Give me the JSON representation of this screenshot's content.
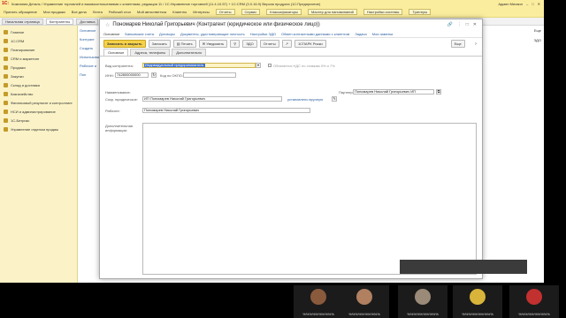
{
  "app": {
    "logo": "1С:",
    "window_title": "Компания Деталь / Управление торговлей и взаимоотношениями с клиентами, редакция 11 / 1С:Управление торговлей (11.4.10.57) + 1С:CRM (3.0.16.9) Версия продукта (1С:Предприятие)",
    "user": "Админ Михаил"
  },
  "menu": {
    "items": [
      "Принять обращение",
      "Мои продажи",
      "Все дела",
      "Лента",
      "Рабочий стол",
      "Мой автоответчик",
      "Клиенты",
      "Интересы"
    ],
    "dropdowns": [
      "Отчеты",
      "Сервис",
      "Классификаторы",
      "Мастер для напоминаний",
      "Настройки системы",
      "Триггеры"
    ]
  },
  "tabs": [
    "Начальная страница",
    "Контрагенты",
    "Доставка"
  ],
  "sidebar": {
    "items": [
      {
        "label": "Главное"
      },
      {
        "label": "1С:CRM"
      },
      {
        "label": "Планирование"
      },
      {
        "label": "CRM и маркетинг"
      },
      {
        "label": "Продажи"
      },
      {
        "label": "Закупки"
      },
      {
        "label": "Склад и доставка"
      },
      {
        "label": "Казначейство"
      },
      {
        "label": "Финансовый результат и контроллинг"
      },
      {
        "label": "НСИ и администрирование"
      },
      {
        "label": "1С-Битрикс"
      },
      {
        "label": "Управление отделом продаж"
      }
    ]
  },
  "background": {
    "left": [
      "Основное",
      "Контраге",
      "Создать",
      "Использование",
      "Рабочие и",
      "Пон"
    ],
    "right": [
      "Еще",
      "ЭДО",
      ""
    ]
  },
  "form": {
    "title": "Пономарев Николай Григорьевич (Контрагент (юридическое или физическое лицо))",
    "title_star": "☆",
    "links": [
      "Основное",
      "Банковские счета",
      "Договоры",
      "Документы, удостоверяющие личность",
      "Настройки ЭДО",
      "Обмен контактными данными с клиентом",
      "Задачи",
      "Мои заметки"
    ],
    "toolbar": {
      "save_close": "Записать и закрыть",
      "save": "Записать",
      "print": "Печать",
      "notify": "Уведомить",
      "edo": "ЭДО",
      "reports": "Отчеты",
      "sparks": "1СПАРК Риски",
      "more": "Еще"
    },
    "tabs": [
      "Основное",
      "Адреса, телефоны",
      "Дополнительно"
    ],
    "fields": {
      "kind_label": "Вид контрагента:",
      "kind_value": "Индивидуальный предприниматель",
      "vat_label": "Облагается НДС по ставкам 0% и 7%",
      "inn_label": "ИНН:",
      "inn_value": "742800000000",
      "okpo_label": "Код по ОКПО:",
      "okpo_value": "",
      "naming_label": "Наименование:",
      "legal_label": "Сокр. юридическое:",
      "legal_value": "ИП Пономарев Николай Григорьевич",
      "link_set": "установлено вручную",
      "partner_label": "Партнер:",
      "partner_value": "Пономарев Николай Григорьевич ИП",
      "working_label": "Рабочее:",
      "working_value": "Пономарев Николай Григорьевич",
      "extra_label": "Дополнительная информация:"
    }
  },
  "participants": [
    {
      "name": "%%%%%%%%%%",
      "color": "#8a5a3c"
    },
    {
      "name": "%%%%%%%%%%",
      "color": "#b08060"
    },
    {
      "name": "%%%%%%%%%%",
      "color": "#9b8a78"
    },
    {
      "name": "%%%%%%%%%%",
      "color": "#d8b43a"
    },
    {
      "name": "%%%%%%%%%%",
      "color": "#c23030"
    }
  ]
}
